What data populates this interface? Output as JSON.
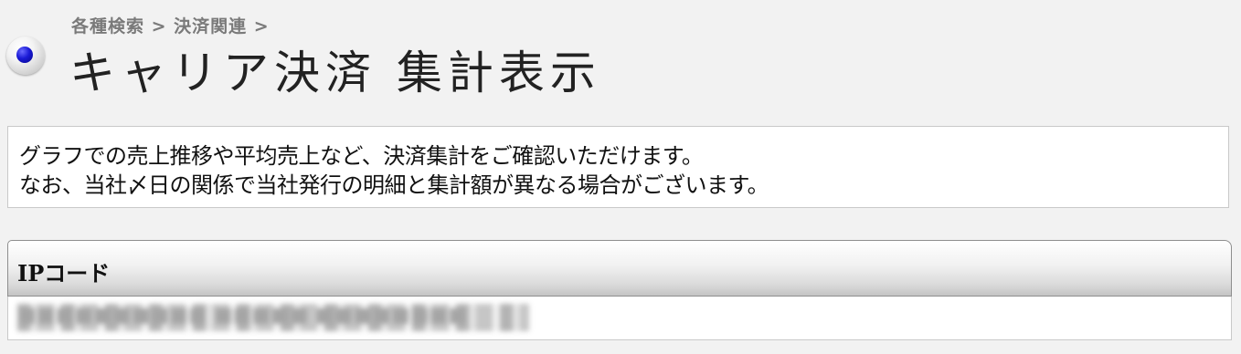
{
  "header": {
    "breadcrumb": "各種検索 > 決済関連 >",
    "title": "キャリア決済 集計表示"
  },
  "description": {
    "line1": "グラフでの売上推移や平均売上など、決済集計をご確認いただけます。",
    "line2": "なお、当社〆日の関係で当社発行の明細と集計額が異なる場合がございます。"
  },
  "ip_panel": {
    "header_label": "IPコード",
    "value": "■■■■■■■■■■ ■■■■■ ■■■■■■■■"
  },
  "colors": {
    "page_background": "#f2f2f2",
    "bullet_accent": "#1a1ad6"
  },
  "icons": {
    "title_bullet": "radio-bullet-icon"
  }
}
